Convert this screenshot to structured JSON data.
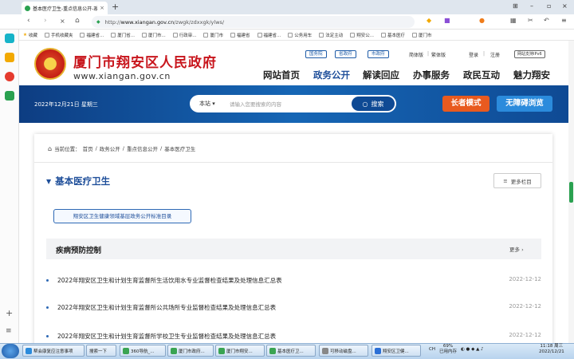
{
  "browser": {
    "tab_title": "基本医疗卫生-重点信息公开-政务...",
    "url_prefix": "http://",
    "url_host": "www.xiangan.gov.cn",
    "url_path": "/zwgk/zdxxgk/ylws/",
    "bookmarks": [
      "收藏",
      "手机收藏夹",
      "福建省...",
      "厦门省...",
      "厦门市...",
      "行政审...",
      "厦门市",
      "福建省",
      "福建省...",
      "公务用车",
      "法定主动",
      "翔安公...",
      "基本医疗",
      "厦门市"
    ]
  },
  "site": {
    "name": "厦门市翔安区人民政府",
    "domain": "www.xiangan.gov.cn",
    "top_links": [
      "国务院",
      "省政府",
      "市政府"
    ],
    "lang": "简体版",
    "lang2": "繁体版",
    "login": "登录",
    "register": "注册",
    "ipv6": "网站支持IPv6",
    "nav": [
      "网站首页",
      "政务公开",
      "解读回应",
      "办事服务",
      "政民互动",
      "魅力翔安"
    ],
    "active_nav": "政务公开",
    "date": "2022年12月21日 星期三",
    "search_scope": "本站",
    "search_placeholder": "请输入您要搜索的内容",
    "search_button": "搜索",
    "elder_mode": "长者模式",
    "accessible": "无障碍浏览"
  },
  "content": {
    "breadcrumb_label": "当前位置：",
    "breadcrumb": [
      "首页",
      "政务公开",
      "重点信息公开",
      "基本医疗卫生"
    ],
    "section_title": "基本医疗卫生",
    "more_columns": "更多栏目",
    "tag": "翔安区卫生健康领域基层政务公开标准目录",
    "subsection": "疾病预防控制",
    "more": "更多",
    "items": [
      {
        "title": "2022年翔安区卫生和计划生育监督所生活饮用水专业监督检查结果及处理信息汇总表",
        "date": "2022-12-12"
      },
      {
        "title": "2022年翔安区卫生和计划生育监督所公共场所专业监督检查结果及处理信息汇总表",
        "date": "2022-12-12"
      },
      {
        "title": "2022年翔安区卫生和计划生育监督所学校卫生专业监督检查结果及处理信息汇总表",
        "date": "2022-12-12"
      }
    ]
  },
  "taskbar": {
    "tasks": [
      "帮会康复应注意事项",
      "搜索一下",
      "360导航_...",
      "厦门市政府...",
      "厦门市翔安...",
      "基本医疗卫...",
      "可移动磁盘...",
      "翔安区卫健..."
    ],
    "battery": "69%",
    "battery_label": "已用内存",
    "time": "11:18 周三",
    "date": "2022/12/21"
  },
  "colors": {
    "brand_red": "#c8161d",
    "nav_blue": "#0f4a94",
    "elder": "#e85a1f",
    "access": "#2b8bdc"
  }
}
